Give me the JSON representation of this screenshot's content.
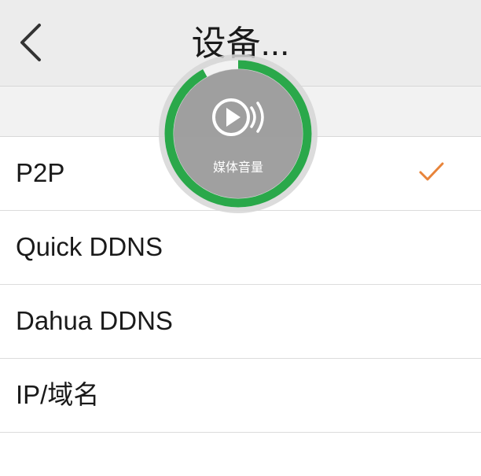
{
  "nav": {
    "title": "设备...",
    "back_icon": "chevron-left-icon"
  },
  "list": {
    "items": [
      {
        "label": "P2P",
        "selected": true
      },
      {
        "label": "Quick DDNS",
        "selected": false
      },
      {
        "label": "Dahua DDNS",
        "selected": false
      },
      {
        "label": "IP/域名",
        "selected": false
      }
    ]
  },
  "volume_hud": {
    "label": "媒体音量",
    "icon": "play-speaker-icon",
    "level": 0.92
  },
  "colors": {
    "accent_check": "#e8843a",
    "volume_ring": "#2aa84a",
    "nav_background": "#ececec"
  }
}
